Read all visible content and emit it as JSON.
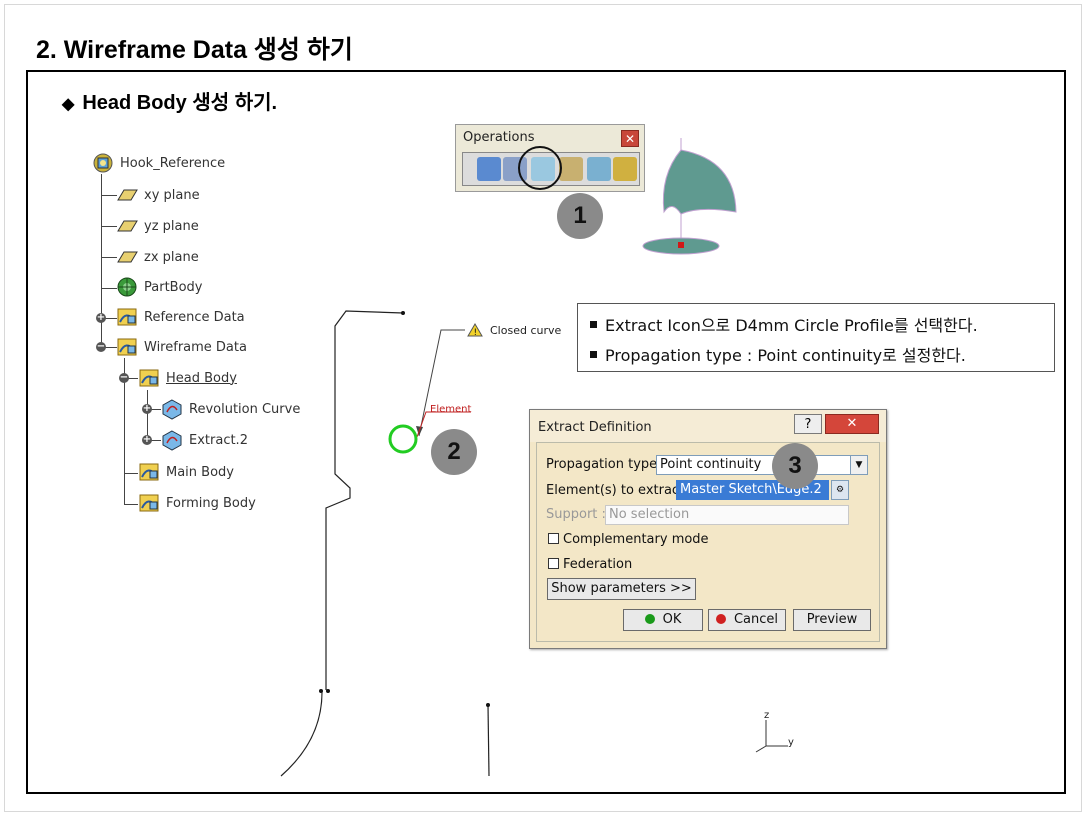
{
  "page": {
    "title": "2. Wireframe Data 생성 하기",
    "section_title": "Head Body 생성 하기.",
    "section_bullet": "◆"
  },
  "tree": {
    "items": [
      {
        "label": "Hook_Reference",
        "icon": "part-icon"
      },
      {
        "label": "xy plane",
        "icon": "plane-icon"
      },
      {
        "label": "yz plane",
        "icon": "plane-icon"
      },
      {
        "label": "zx plane",
        "icon": "plane-icon"
      },
      {
        "label": "PartBody",
        "icon": "body-icon"
      },
      {
        "label": "Reference Data",
        "icon": "geometrical-set-icon"
      },
      {
        "label": "Wireframe Data",
        "icon": "geometrical-set-icon"
      },
      {
        "label": "Head Body",
        "icon": "geometrical-set-icon"
      },
      {
        "label": "Revolution Curve",
        "icon": "feature-icon"
      },
      {
        "label": "Extract.2",
        "icon": "feature-icon"
      },
      {
        "label": "Main Body",
        "icon": "geometrical-set-icon"
      },
      {
        "label": "Forming Body",
        "icon": "geometrical-set-icon"
      }
    ]
  },
  "toolbar": {
    "title": "Operations",
    "close_glyph": "✕"
  },
  "badges": {
    "one": "1",
    "two": "2",
    "three": "3"
  },
  "instructions": {
    "line1": "Extract Icon으로 D4mm Circle Profile를 선택한다.",
    "line2": "Propagation type : Point continuity로 설정한다."
  },
  "viewport": {
    "closed_curve_label": "Closed curve",
    "element_label": "Element",
    "axis_z": "z",
    "axis_y": "y"
  },
  "dialog": {
    "title": "Extract Definition",
    "help_glyph": "?",
    "close_glyph": "✕",
    "propagation_label": "Propagation type:",
    "propagation_value": "Point continuity",
    "elements_label": "Element(s) to extract:",
    "elements_value": "Master Sketch\\Edge.2",
    "support_label": "Support :",
    "support_placeholder": "No selection",
    "complementary_label": "Complementary mode",
    "federation_label": "Federation",
    "show_params_label": "Show parameters >>",
    "ok_label": "OK",
    "cancel_label": "Cancel",
    "preview_label": "Preview"
  },
  "colors": {
    "dialog_bg": "#f3e7c7",
    "selection": "#3a7bd5",
    "circle_profile": "#22cc22",
    "close_red": "#d4463a",
    "badge_gray": "#8a8a8a"
  }
}
